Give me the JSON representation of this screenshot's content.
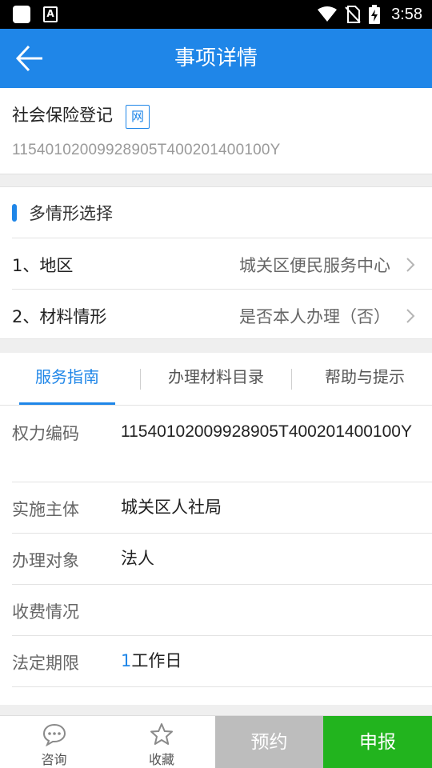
{
  "status_bar": {
    "time": "3:58",
    "icon_b_letter": "A"
  },
  "header": {
    "title": "事项详情"
  },
  "item": {
    "name": "社会保险登记",
    "tag": "网",
    "code": "11540102009928905T400201400100Y"
  },
  "multi_scenario": {
    "title": "多情形选择",
    "rows": [
      {
        "label": "1、地区",
        "value": "城关区便民服务中心"
      },
      {
        "label": "2、材料情形",
        "value": "是否本人办理（否）"
      }
    ]
  },
  "tabs": [
    {
      "label": "服务指南",
      "active": true
    },
    {
      "label": "办理材料目录",
      "active": false
    },
    {
      "label": "帮助与提示",
      "active": false
    }
  ],
  "guide": [
    {
      "label": "权力编码",
      "value": "11540102009928905T400201400100Y"
    },
    {
      "label": "实施主体",
      "value": "城关区人社局"
    },
    {
      "label": "办理对象",
      "value": "法人"
    },
    {
      "label": "收费情况",
      "value": ""
    },
    {
      "label": "法定期限",
      "value_num": "1",
      "value_unit": "工作日"
    }
  ],
  "bottom_bar": {
    "consult_label": "咨询",
    "favorite_label": "收藏",
    "reserve_label": "预约",
    "apply_label": "申报"
  },
  "colors": {
    "primary": "#1f86e8",
    "apply": "#22b41e",
    "reserve": "#bdbdbd"
  }
}
